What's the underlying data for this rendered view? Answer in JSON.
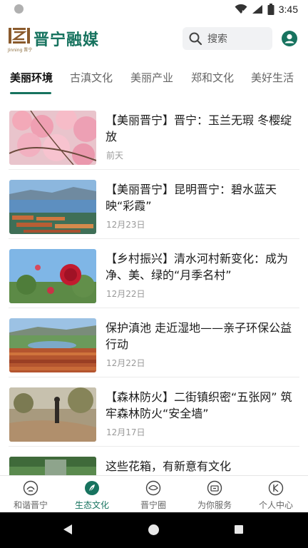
{
  "status_bar": {
    "time": "3:45",
    "icons": [
      "wifi-icon",
      "signal-icon",
      "battery-icon"
    ]
  },
  "header": {
    "logo_text": "晋宁融媒",
    "logo_subtext": "Jinning 晋宁",
    "search_placeholder": "搜索",
    "accent_color": "#17735f"
  },
  "tabs": [
    {
      "label": "美丽环境",
      "active": true
    },
    {
      "label": "古滇文化",
      "active": false
    },
    {
      "label": "美丽产业",
      "active": false
    },
    {
      "label": "郑和文化",
      "active": false
    },
    {
      "label": "美好生活",
      "active": false
    }
  ],
  "articles": [
    {
      "title": "【美丽晋宁】晋宁：玉兰无瑕 冬樱绽放",
      "date": "前天",
      "thumb": "cherry-blossom"
    },
    {
      "title": "【美丽晋宁】昆明晋宁：碧水蓝天映“彩霞”",
      "date": "12月23日",
      "thumb": "lake-aerial"
    },
    {
      "title": "【乡村振兴】清水河村新变化：成为净、美、绿的“月季名村”",
      "date": "12月22日",
      "thumb": "rose"
    },
    {
      "title": "保护滇池 走近湿地——亲子环保公益行动",
      "date": "12月22日",
      "thumb": "wetland"
    },
    {
      "title": "【森林防火】二街镇织密“五张网” 筑牢森林防火“安全墙”",
      "date": "12月17日",
      "thumb": "forest"
    },
    {
      "title": "这些花箱，有新意有文化",
      "date": "",
      "thumb": "flower-box"
    }
  ],
  "bottom_nav": [
    {
      "label": "和谐晋宁",
      "icon": "harmony-icon",
      "active": false
    },
    {
      "label": "生态文化",
      "icon": "ecology-icon",
      "active": true
    },
    {
      "label": "晋宁圈",
      "icon": "circle-icon",
      "active": false
    },
    {
      "label": "为你服务",
      "icon": "service-icon",
      "active": false
    },
    {
      "label": "个人中心",
      "icon": "profile-icon",
      "active": false
    }
  ]
}
